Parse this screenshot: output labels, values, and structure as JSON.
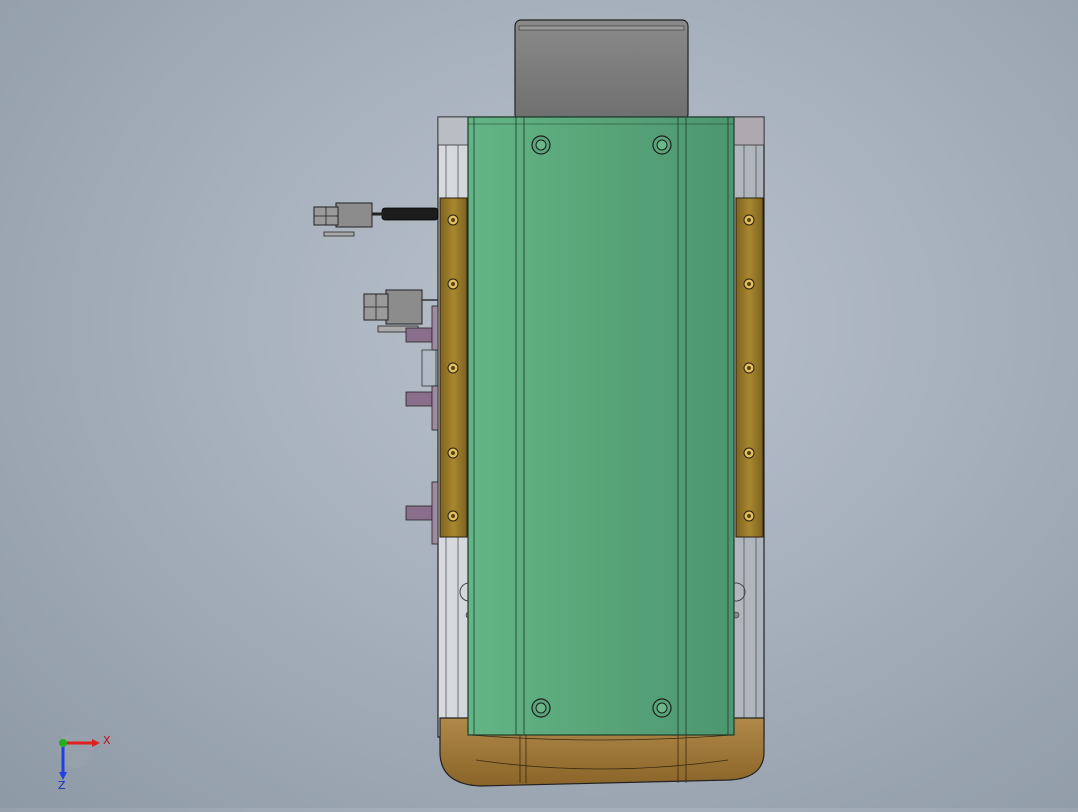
{
  "viewport": {
    "background_top": "#b9c1cb",
    "background_bottom": "#8e99a6"
  },
  "model": {
    "colors": {
      "carriage_green": "#5aa57a",
      "side_rail_brass": "#9a7a2a",
      "end_cap_bronze": "#a07838",
      "motor_gray": "#7e7e7e",
      "frame_silver": "#c9ced4",
      "connector_gray": "#8c8c8c",
      "bracket_mauve": "#8a6f8c"
    },
    "icons": [
      "screw-head-icon",
      "connector-icon",
      "cable-icon"
    ]
  },
  "triad": {
    "x_label": "X",
    "z_label": "Z",
    "x_color": "#e02020",
    "y_color": "#20b020",
    "z_color": "#2040e0"
  }
}
